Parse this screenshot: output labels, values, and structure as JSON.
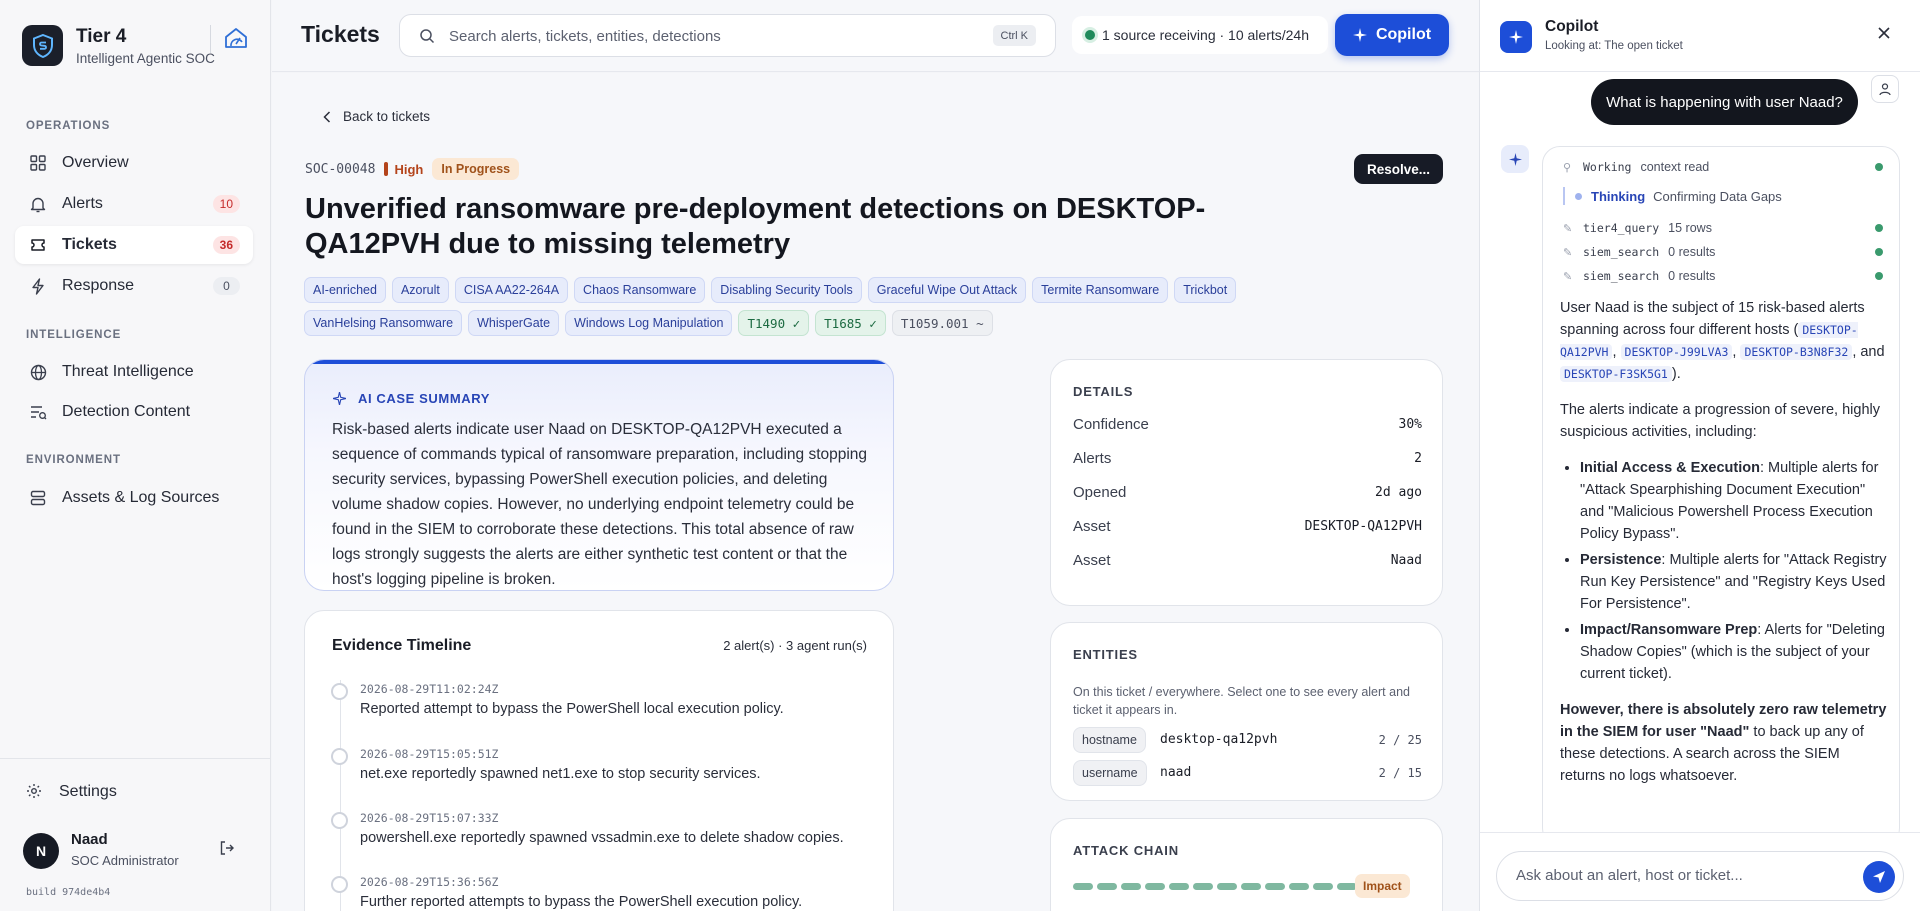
{
  "brand": {
    "name": "Tier 4",
    "subtitle": "Intelligent Agentic SOC"
  },
  "nav": {
    "operations_label": "OPERATIONS",
    "intelligence_label": "INTELLIGENCE",
    "environment_label": "ENVIRONMENT",
    "items": [
      {
        "label": "Overview",
        "icon": "grid-icon"
      },
      {
        "label": "Alerts",
        "icon": "bell-icon",
        "badge": "10"
      },
      {
        "label": "Tickets",
        "icon": "ticket-icon",
        "badge": "36",
        "active": true
      },
      {
        "label": "Response",
        "icon": "bolt-icon",
        "badge": "0"
      },
      {
        "label": "Threat Intelligence",
        "icon": "globe-icon"
      },
      {
        "label": "Detection Content",
        "icon": "list-icon"
      },
      {
        "label": "Assets & Log Sources",
        "icon": "server-icon"
      }
    ],
    "settings_label": "Settings"
  },
  "user": {
    "initial": "N",
    "name": "Naad",
    "role": "SOC Administrator",
    "build": "build 974de4b4"
  },
  "topbar": {
    "title": "Tickets",
    "search_placeholder": "Search alerts, tickets, entities, detections",
    "search_shortcut": "Ctrl K",
    "status": "1 source receiving · 10 alerts/24h",
    "copilot_label": "Copilot"
  },
  "ticket": {
    "back_label": "Back to tickets",
    "id": "SOC-00048",
    "severity": "High",
    "state": "In Progress",
    "resolve_label": "Resolve...",
    "title": "Unverified ransomware pre-deployment detections on DESKTOP-QA12PVH due to missing telemetry",
    "tags": [
      {
        "label": "AI-enriched",
        "kind": "blue"
      },
      {
        "label": "Azorult",
        "kind": "blue"
      },
      {
        "label": "CISA AA22-264A",
        "kind": "blue"
      },
      {
        "label": "Chaos Ransomware",
        "kind": "blue"
      },
      {
        "label": "Disabling Security Tools",
        "kind": "blue"
      },
      {
        "label": "Graceful Wipe Out Attack",
        "kind": "blue"
      },
      {
        "label": "Termite Ransomware",
        "kind": "blue"
      },
      {
        "label": "Trickbot",
        "kind": "blue"
      },
      {
        "label": "VanHelsing Ransomware",
        "kind": "blue"
      },
      {
        "label": "WhisperGate",
        "kind": "blue"
      },
      {
        "label": "Windows Log Manipulation",
        "kind": "blue"
      },
      {
        "label": "T1490 ✓",
        "kind": "green"
      },
      {
        "label": "T1685 ✓",
        "kind": "green"
      },
      {
        "label": "T1059.001 ~",
        "kind": "gray"
      }
    ]
  },
  "summary": {
    "heading": "AI CASE SUMMARY",
    "text": "Risk-based alerts indicate user Naad on DESKTOP-QA12PVH executed a sequence of commands typical of ransomware preparation, including stopping security services, bypassing PowerShell execution policies, and deleting volume shadow copies. However, no underlying endpoint telemetry could be found in the SIEM to corroborate these detections. This total absence of raw logs strongly suggests the alerts are either synthetic test content or that the host's logging pipeline is broken."
  },
  "timeline": {
    "heading": "Evidence Timeline",
    "count": "2 alert(s) · 3 agent run(s)",
    "events": [
      {
        "time": "2026-08-29T11:02:24Z",
        "text": "Reported attempt to bypass the PowerShell local execution policy."
      },
      {
        "time": "2026-08-29T15:05:51Z",
        "text": "net.exe reportedly spawned net1.exe to stop security services."
      },
      {
        "time": "2026-08-29T15:07:33Z",
        "text": "powershell.exe reportedly spawned vssadmin.exe to delete shadow copies."
      },
      {
        "time": "2026-08-29T15:36:56Z",
        "text": "Further reported attempts to bypass the PowerShell execution policy."
      }
    ]
  },
  "details": {
    "heading": "DETAILS",
    "rows": [
      {
        "label": "Confidence",
        "value": "30%"
      },
      {
        "label": "Alerts",
        "value": "2"
      },
      {
        "label": "Opened",
        "value": "2d ago"
      },
      {
        "label": "Asset",
        "value": "DESKTOP-QA12PVH"
      },
      {
        "label": "Asset",
        "value": "Naad"
      }
    ]
  },
  "entities": {
    "heading": "ENTITIES",
    "description": "On this ticket / everywhere. Select one to see every alert and ticket it appears in.",
    "rows": [
      {
        "type": "hostname",
        "value": "desktop-qa12pvh",
        "count": "2 / 25"
      },
      {
        "type": "username",
        "value": "naad",
        "count": "2 / 15"
      }
    ]
  },
  "attack_chain": {
    "heading": "ATTACK CHAIN",
    "stage": "Impact",
    "segments": 12
  },
  "copilot": {
    "title": "Copilot",
    "subtitle": "Looking at: The open ticket",
    "user_message": "What is happening with user Naad?",
    "steps": {
      "working_label": "Working",
      "working_detail": "context read",
      "thinking_label": "Thinking",
      "thinking_detail": "Confirming Data Gaps",
      "tools": [
        {
          "name": "tier4_query",
          "result": "15 rows"
        },
        {
          "name": "siem_search",
          "result": "0 results"
        },
        {
          "name": "siem_search",
          "result": "0 results"
        }
      ]
    },
    "answer": {
      "p1_lead": "User Naad is the subject of 15 risk-based alerts spanning across four different hosts (",
      "hosts": [
        "DESKTOP-QA12PVH",
        "DESKTOP-J99LVA3",
        "DESKTOP-B3N8F32",
        "DESKTOP-F3SK5G1"
      ],
      "p1_sep": ", ",
      "p1_and": ", and ",
      "p1_tail": ").",
      "p2": "The alerts indicate a progression of severe, highly suspicious activities, including:",
      "bullets": [
        {
          "title": "Initial Access & Execution",
          "text": ": Multiple alerts for \"Attack Spearphishing Document Execution\" and \"Malicious Powershell Process Execution Policy Bypass\"."
        },
        {
          "title": "Persistence",
          "text": ": Multiple alerts for \"Attack Registry Run Key Persistence\" and \"Registry Keys Used For Persistence\"."
        },
        {
          "title": "Impact/Ransomware Prep",
          "text": ": Alerts for \"Deleting Shadow Copies\" (which is the subject of your current ticket)."
        }
      ],
      "p3_bold": "However, there is absolutely zero raw telemetry in the SIEM for user \"Naad\"",
      "p3_rest": " to back up any of these detections. A search across the SIEM returns no logs whatsoever."
    },
    "input_placeholder": "Ask about an alert, host or ticket..."
  }
}
